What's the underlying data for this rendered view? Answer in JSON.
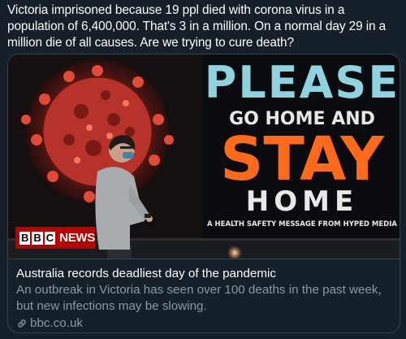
{
  "tweet": {
    "text": "Victoria imprisoned because 19 ppl died with corona virus in a population of 6,400,000. That's 3 in a million. On a normal day 29 in a million die of all causes. Are we trying to cure death?"
  },
  "card": {
    "image": {
      "sign_line1": "PLEASE",
      "sign_line2": "GO HOME AND",
      "sign_line3": "STAY",
      "sign_line4": "HOME",
      "sign_footer": "A HEALTH SAFETY MESSAGE FROM HYPED MEDIA",
      "badge_box": "B",
      "badge_box2": "B",
      "badge_box3": "C",
      "badge_news": "NEWS"
    },
    "title": "Australia records deadliest day of the pandemic",
    "description": "An outbreak in Victoria has seen over 100 deaths in the past week, but new infections may be slowing.",
    "domain": "bbc.co.uk"
  },
  "colors": {
    "background": "#15202b",
    "border": "#38444d",
    "secondary_text": "#8899a6",
    "sign_teal": "#8fd3df",
    "sign_orange": "#ff6a1a",
    "virus_red": "#c8332a",
    "bbc_red": "#b80000"
  }
}
